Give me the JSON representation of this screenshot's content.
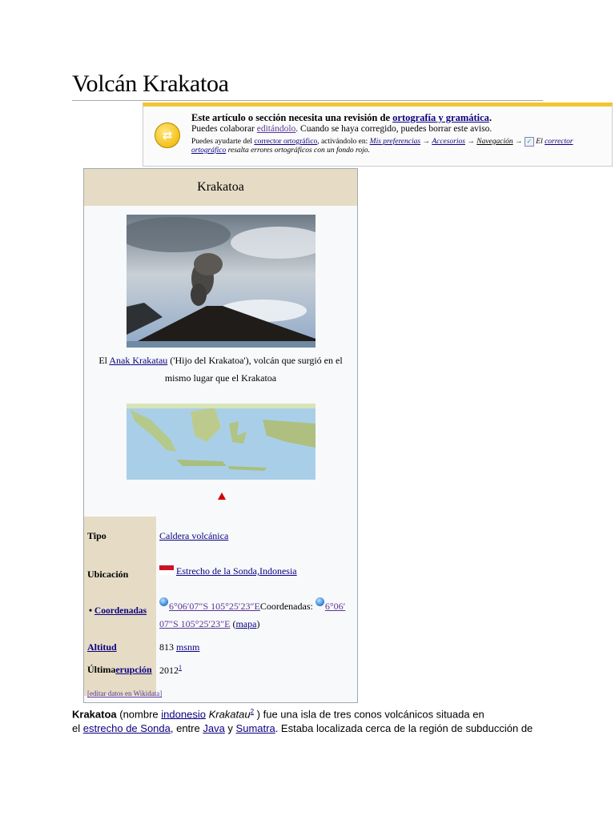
{
  "page_title": "Volcán Krakatoa",
  "notice": {
    "line1_prefix": "Este artículo o sección necesita una revisión de ",
    "line1_link": "ortografía y gramática",
    "line1_suffix": ".",
    "line2_prefix": "Puedes colaborar ",
    "line2_link": "editándolo",
    "line2_suffix": ". Cuando se haya corregido, puedes borrar este aviso.",
    "line3_prefix": "Puedes ayudarte del ",
    "line3_link1": "corrector ortográfico",
    "line3_mid": ", activándolo en: ",
    "line3_link2": "Mis preferencias",
    "arrow": " → ",
    "line3_link3": "Accesorios",
    "line3_link4": "Navegación",
    "line3_el": " El ",
    "line3_link5": "corrector",
    "line4_link": "ortográfico",
    "line4_suffix": " resalta errores ortográficos con un fondo rojo."
  },
  "infobox": {
    "title": "Krakatoa",
    "caption_prefix": "El ",
    "caption_link": "Anak Krakatau",
    "caption_suffix": " ('Hijo del Krakatoa'), volcán que surgió en el mismo lugar que el Krakatoa",
    "rows": {
      "tipo_label": "Tipo",
      "tipo_value": "Caldera volcánica",
      "ubicacion_label": "Ubicación",
      "ubicacion_value": "Estrecho de la Sonda,Indonesia",
      "coord_bullet": "• ",
      "coord_label": "Coordenadas",
      "coord_v1": "6°06′07″S 105°25′23″E",
      "coord_v2": "Coordenadas: ",
      "coord_v3": "6°06′",
      "coord_v4": "07″S 105°25′23″E",
      "coord_paren_open": " (",
      "coord_mapa": "mapa",
      "coord_paren_close": ")",
      "altitud_label": "Altitud",
      "altitud_value": "813 ",
      "altitud_unit": "msnm",
      "erupcion_label_plain": "Última",
      "erupcion_label_link": "erupción",
      "erupcion_value": "2012",
      "erupcion_ref": "1"
    },
    "edit_link": "[editar datos en Wikidata]"
  },
  "body": {
    "p1_bold": "Krakatoa",
    "p1_a": " (nombre ",
    "p1_link1": "indonesio",
    "p1_b": " ",
    "p1_italic": "Krakatau",
    "p1_ref": "2",
    "p1_c": " ) fue una isla de tres conos volcánicos situada en",
    "p2_a": "el ",
    "p2_link1": "estrecho de Sonda",
    "p2_b": ", entre ",
    "p2_link2": "Java",
    "p2_c": " y ",
    "p2_link3": "Sumatra",
    "p2_d": ". Estaba localizada cerca de la región de subducción de"
  }
}
